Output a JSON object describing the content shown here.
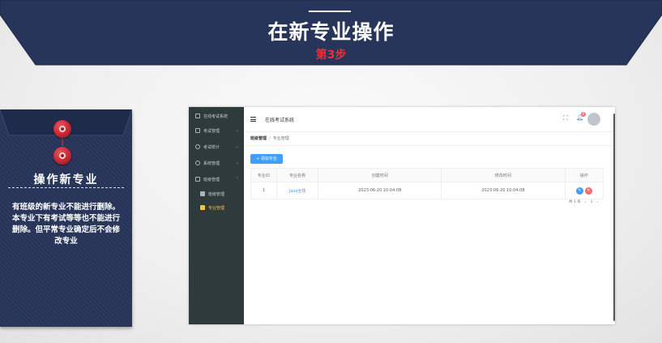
{
  "banner": {
    "title": "在新专业操作",
    "step": "第3步"
  },
  "card": {
    "title": "操作新专业",
    "body": "有班级的新专业不能进行删除。本专业下有考试等等也不能进行删除。但平常专业确定后不会修改专业"
  },
  "app": {
    "sidebar": {
      "brand": "在线考试系统",
      "items": [
        {
          "label": "考试管理",
          "icon": "doc-icon"
        },
        {
          "label": "考试统计",
          "icon": "clock-icon"
        },
        {
          "label": "系统管理",
          "icon": "gear-icon"
        },
        {
          "label": "班级管理",
          "icon": "class-icon"
        },
        {
          "label": "班级管理",
          "icon": "home-icon"
        },
        {
          "label": "专业管理",
          "icon": "major-icon"
        }
      ]
    },
    "topbar": {
      "title": "在线考试系统",
      "notification_count": "0"
    },
    "breadcrumb": {
      "root": "班级管理",
      "current": "专业管理"
    },
    "add_button": "+ 添加专业",
    "table": {
      "headers": [
        "专业ID",
        "专业名称",
        "创建时间",
        "修改时间",
        "操作"
      ],
      "rows": [
        {
          "id": "1",
          "name": "Java全栈",
          "created": "2023-06-20 10:04:08",
          "modified": "2023-06-20 10:04:08"
        }
      ]
    },
    "pager": {
      "total": "共 1 条",
      "prev": "‹",
      "page": "1",
      "next": "›"
    }
  },
  "colors": {
    "navy": "#27355a",
    "accent_red": "#e8323c",
    "primary": "#409eff",
    "danger": "#f56c6c",
    "sidebar_bg": "#2f3a3c",
    "sidebar_active": "#f5c542"
  }
}
